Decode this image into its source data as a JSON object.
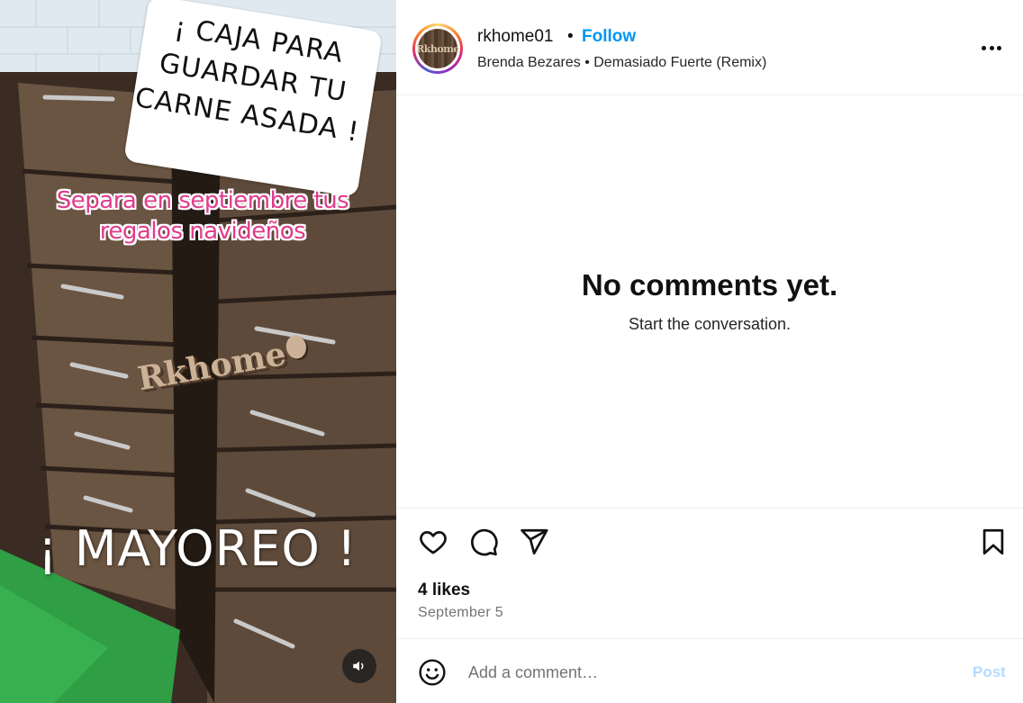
{
  "media": {
    "caption_lines": [
      "¡ CAJA PARA",
      "GUARDAR TU",
      "CARNE ASADA !"
    ],
    "promo_lines": [
      "Separa en septiembre tus",
      "regalos navideños"
    ],
    "brand_logo": "Rkhome",
    "headline": "¡ MAYOREO !",
    "sound_icon": "speaker-icon"
  },
  "header": {
    "avatar_label": "Rkhome",
    "username": "rkhome01",
    "separator": "•",
    "follow_label": "Follow",
    "audio_artist": "Brenda Bezares",
    "audio_separator": "•",
    "audio_track": "Demasiado Fuerte (Remix)",
    "more_icon": "more-horizontal-icon"
  },
  "comments": {
    "empty_title": "No comments yet.",
    "empty_subtitle": "Start the conversation."
  },
  "actions": {
    "like_icon": "heart-icon",
    "comment_icon": "comment-bubble-icon",
    "share_icon": "paper-plane-icon",
    "save_icon": "bookmark-icon",
    "likes_text": "4 likes",
    "date_text": "September 5"
  },
  "composer": {
    "emoji_icon": "emoji-icon",
    "placeholder": "Add a comment…",
    "value": "",
    "post_label": "Post"
  },
  "colors": {
    "follow": "#0095f6",
    "post_disabled": "#b3dbff",
    "promo_pink": "#e03c8c",
    "secondary_text": "#737373"
  }
}
